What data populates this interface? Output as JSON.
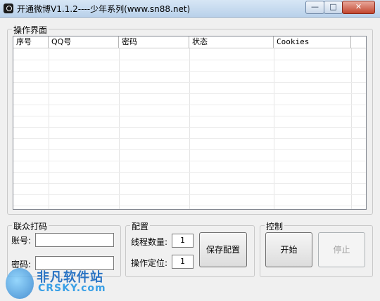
{
  "window": {
    "title": "开通微博V1.1.2----少年系列(www.sn88.net)",
    "controls": {
      "minimize": "—",
      "maximize": "□",
      "close": "✕"
    }
  },
  "operation_panel": {
    "title": "操作界面",
    "columns": [
      "序号",
      "QQ号",
      "密码",
      "状态",
      "Cookies"
    ],
    "rows": []
  },
  "captcha_panel": {
    "title": "联众打码",
    "account_label": "账号:",
    "account_value": "",
    "password_label": "密码:",
    "password_value": ""
  },
  "config_panel": {
    "title": "配置",
    "threads_label": "线程数量:",
    "threads_value": "1",
    "position_label": "操作定位:",
    "position_value": "1",
    "save_button": "保存配置"
  },
  "control_panel": {
    "title": "控制",
    "start_button": "开始",
    "stop_button": "停止"
  },
  "watermark": {
    "line1": "非凡软件站",
    "line2": "CRSKY.com"
  }
}
